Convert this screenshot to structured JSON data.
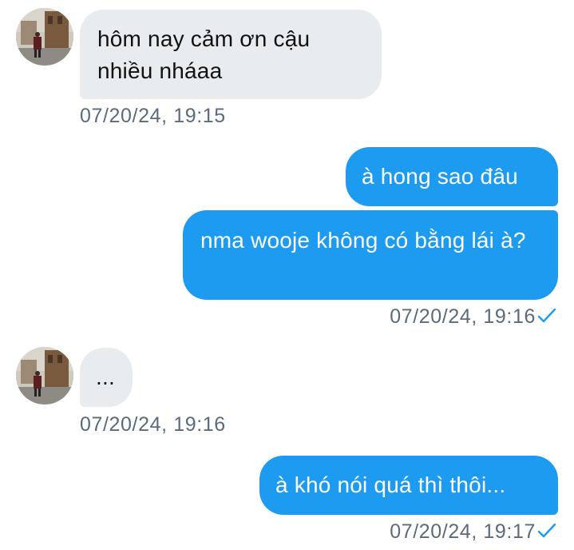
{
  "conversation": {
    "messages": [
      {
        "direction": "incoming",
        "text": "hôm nay cảm ơn cậu nhiều nháaa",
        "timestamp": "07/20/24, 19:15"
      },
      {
        "direction": "outgoing",
        "text": "à hong sao đâu"
      },
      {
        "direction": "outgoing",
        "text": "nma wooje không có bằng lái à?",
        "timestamp": "07/20/24, 19:16",
        "status_icon": "check-icon"
      },
      {
        "direction": "incoming",
        "text": "...",
        "timestamp": "07/20/24, 19:16"
      },
      {
        "direction": "outgoing",
        "text": "à khó nói quá thì thôi...",
        "timestamp": "07/20/24, 19:17",
        "status_icon": "check-icon"
      }
    ]
  },
  "colors": {
    "incoming_bubble": "#e9ecef",
    "outgoing_bubble": "#1d9bf0",
    "timestamp_text": "#5b6b7a",
    "read_check": "#1d9bf0"
  }
}
